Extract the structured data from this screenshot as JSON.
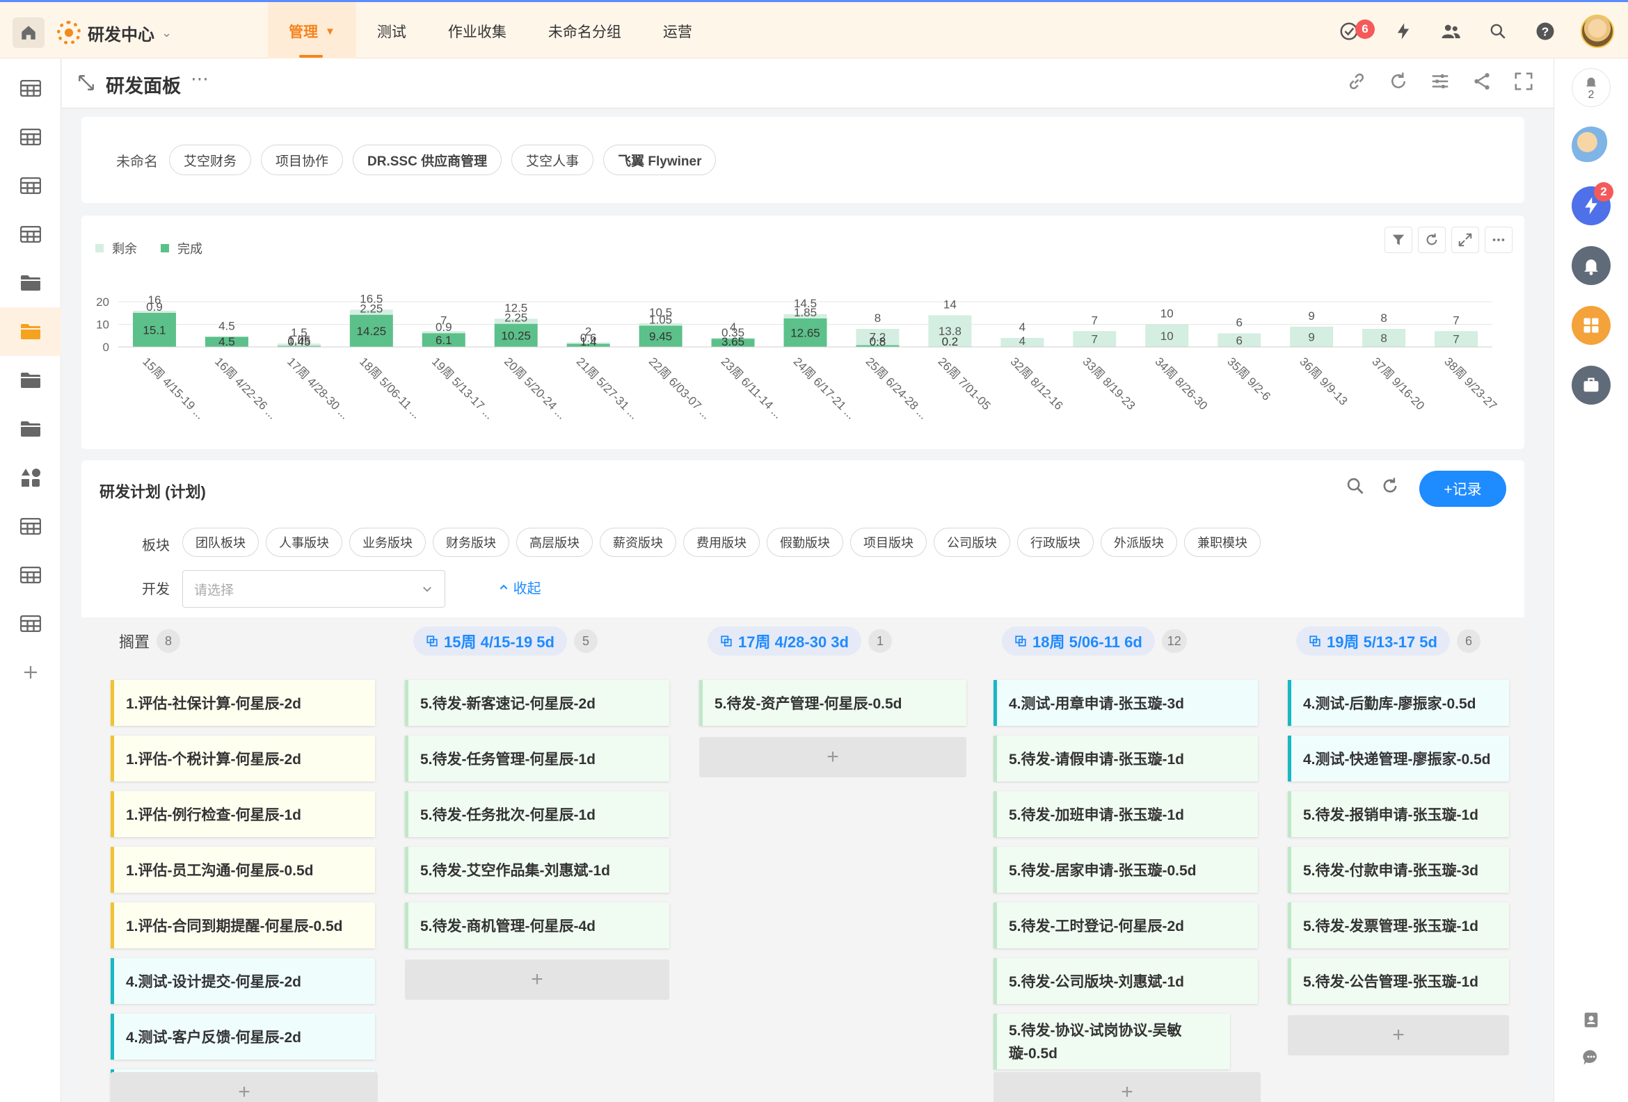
{
  "topbar": {
    "workspace": "研发中心",
    "nav": [
      {
        "label": "管理",
        "active": true
      },
      {
        "label": "测试"
      },
      {
        "label": "作业收集"
      },
      {
        "label": "未命名分组"
      },
      {
        "label": "运营"
      }
    ],
    "todo_badge": "6"
  },
  "header": {
    "title": "研发面板"
  },
  "app_filter": {
    "label": "未命名",
    "tags": [
      "艾空财务",
      "项目协作",
      "DR.SSC 供应商管理",
      "艾空人事",
      "飞翼 Flywiner"
    ]
  },
  "rightbar": {
    "notify_count": "2",
    "quick_badge": "2"
  },
  "colors": {
    "accent": "#1e8bff",
    "brand": "#f5841f",
    "done": "#5cc08a",
    "remaining": "#d4eee1"
  },
  "chart_data": {
    "type": "bar",
    "stacked": true,
    "legend_position": "top-left",
    "categories": [
      "15周 4/15-19 ...",
      "16周 4/22-26 ...",
      "17周 4/28-30 ...",
      "18周 5/06-11 ...",
      "19周 5/13-17 ...",
      "20周 5/20-24 ...",
      "21周 5/27-31 ...",
      "22周 6/03-07 ...",
      "23周 6/11-14 ...",
      "24周 6/17-21 ...",
      "25周 6/24-28 ...",
      "26周 7/01-05",
      "32周 8/12-16",
      "33周 8/19-23",
      "34周 8/26-30",
      "35周 9/2-6",
      "36周 9/9-13",
      "37周 9/16-20",
      "38周 9/23-27"
    ],
    "series": [
      {
        "name": "剩余",
        "color": "#d4eee1",
        "values": [
          0.9,
          0,
          1.05,
          2.25,
          0.9,
          2.25,
          0.6,
          1.05,
          0.35,
          1.85,
          7.2,
          13.8,
          4,
          7,
          10,
          6,
          9,
          8,
          7
        ]
      },
      {
        "name": "完成",
        "color": "#5cc08a",
        "values": [
          15.1,
          4.5,
          0.45,
          14.25,
          6.1,
          10.25,
          1.4,
          9.45,
          3.65,
          12.65,
          0.8,
          0.2,
          0,
          0,
          0,
          0,
          0,
          0,
          0
        ]
      }
    ],
    "totals": [
      16,
      4.5,
      1.5,
      16.5,
      7,
      12.5,
      2,
      10.5,
      4,
      14.5,
      8,
      14,
      4,
      7,
      10,
      6,
      9,
      8,
      7
    ],
    "remaining_labels": [
      "0.9",
      "",
      "1.05",
      "2.25",
      "0.9",
      "2.25",
      "0.6",
      "1.05",
      "0.35",
      "1.85",
      "7.2",
      "13.8",
      "4",
      "7",
      "10",
      "6",
      "9",
      "8",
      "7"
    ],
    "done_labels": [
      "15.1",
      "4.5",
      "0.45",
      "14.25",
      "6.1",
      "10.25",
      "1.4",
      "9.45",
      "3.65",
      "12.65",
      "0.8",
      "0.2",
      "",
      "",
      "",
      "",
      "",
      "",
      ""
    ],
    "y_ticks": [
      "20",
      "10",
      "0"
    ],
    "ylim": [
      0,
      20
    ],
    "grid": true
  },
  "plan": {
    "title": "研发计划 (计划)",
    "add_label": "+记录",
    "module_label": "板块",
    "modules": [
      "团队板块",
      "人事版块",
      "业务版块",
      "财务版块",
      "高层版块",
      "薪资版块",
      "费用版块",
      "假勤版块",
      "项目版块",
      "公司版块",
      "行政版块",
      "外派版块",
      "兼职模块"
    ],
    "dev_label": "开发",
    "dev_placeholder": "请选择",
    "fold_label": "收起"
  },
  "board": {
    "columns": [
      {
        "name": "搁置",
        "count": "8",
        "cards": [
          {
            "text": "1.评估-社保计算-何星辰-2d",
            "kind": "eval"
          },
          {
            "text": "1.评估-个税计算-何星辰-2d",
            "kind": "eval"
          },
          {
            "text": "1.评估-例行检查-何星辰-1d",
            "kind": "eval"
          },
          {
            "text": "1.评估-员工沟通-何星辰-0.5d",
            "kind": "eval"
          },
          {
            "text": "1.评估-合同到期提醒-何星辰-0.5d",
            "kind": "eval"
          },
          {
            "text": "4.测试-设计提交-何星辰-2d",
            "kind": "test"
          },
          {
            "text": "4.测试-客户反馈-何星辰-2d",
            "kind": "test"
          }
        ]
      },
      {
        "name": "15周 4/15-19 5d",
        "count": "5",
        "cards": [
          {
            "text": "5.待发-新客速记-何星辰-2d",
            "kind": "wait"
          },
          {
            "text": "5.待发-任务管理-何星辰-1d",
            "kind": "wait"
          },
          {
            "text": "5.待发-任务批次-何星辰-1d",
            "kind": "wait"
          },
          {
            "text": "5.待发-艾空作品集-刘惠斌-1d",
            "kind": "wait"
          },
          {
            "text": "5.待发-商机管理-何星辰-4d",
            "kind": "wait"
          }
        ]
      },
      {
        "name": "17周 4/28-30 3d",
        "count": "1",
        "cards": [
          {
            "text": "5.待发-资产管理-何星辰-0.5d",
            "kind": "wait"
          }
        ]
      },
      {
        "name": "18周 5/06-11 6d",
        "count": "12",
        "cards": [
          {
            "text": "4.测试-用章申请-张玉璇-3d",
            "kind": "test"
          },
          {
            "text": "5.待发-请假申请-张玉璇-1d",
            "kind": "wait"
          },
          {
            "text": "5.待发-加班申请-张玉璇-1d",
            "kind": "wait"
          },
          {
            "text": "5.待发-居家申请-张玉璇-0.5d",
            "kind": "wait"
          },
          {
            "text": "5.待发-工时登记-何星辰-2d",
            "kind": "wait"
          },
          {
            "text": "5.待发-公司版块-刘惠斌-1d",
            "kind": "wait"
          },
          {
            "text": "5.待发-协议-试岗协议-吴敏璇-0.5d",
            "kind": "wait"
          }
        ]
      },
      {
        "name": "19周 5/13-17 5d",
        "count": "6",
        "cards": [
          {
            "text": "4.测试-后勤库-廖振家-0.5d",
            "kind": "test"
          },
          {
            "text": "4.测试-快递管理-廖振家-0.5d",
            "kind": "test"
          },
          {
            "text": "5.待发-报销申请-张玉璇-1d",
            "kind": "wait"
          },
          {
            "text": "5.待发-付款申请-张玉璇-3d",
            "kind": "wait"
          },
          {
            "text": "5.待发-发票管理-张玉璇-1d",
            "kind": "wait"
          },
          {
            "text": "5.待发-公告管理-张玉璇-1d",
            "kind": "wait"
          }
        ]
      }
    ]
  }
}
